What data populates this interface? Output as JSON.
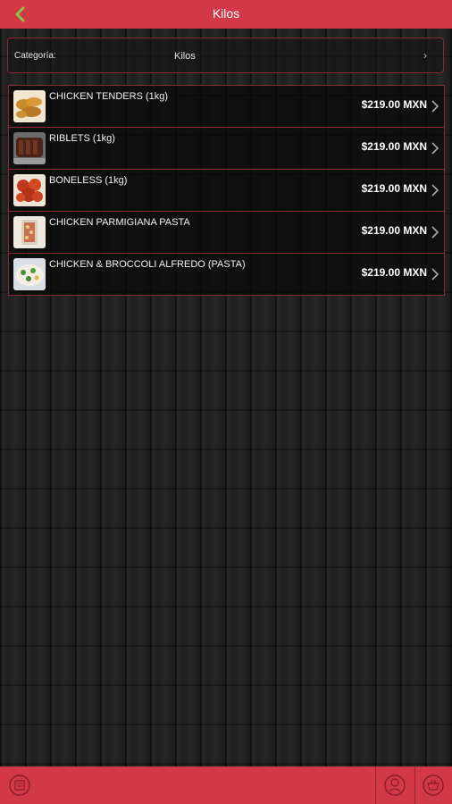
{
  "header": {
    "title": "Kilos",
    "back_icon": "chevron-left-icon",
    "accent_color": "#d13947"
  },
  "category": {
    "label": "Categoría:",
    "value": "Kilos",
    "chevron": "›"
  },
  "products": [
    {
      "name": "CHICKEN TENDERS (1kg)",
      "price": "$219.00 MXN",
      "thumb_icon": "chicken-tenders-photo"
    },
    {
      "name": "RIBLETS (1kg)",
      "price": "$219.00 MXN",
      "thumb_icon": "riblets-photo"
    },
    {
      "name": "BONELESS (1kg)",
      "price": "$219.00 MXN",
      "thumb_icon": "boneless-photo"
    },
    {
      "name": "CHICKEN PARMIGIANA PASTA",
      "price": "$219.00 MXN",
      "thumb_icon": "parmigiana-pasta-photo"
    },
    {
      "name": "CHICKEN & BROCCOLI ALFREDO (PASTA)",
      "price": "$219.00 MXN",
      "thumb_icon": "alfredo-pasta-photo"
    }
  ],
  "bottom_nav": {
    "left_icon": "menu-book-icon",
    "right_icons": [
      "chef-icon",
      "cart-icon"
    ]
  }
}
